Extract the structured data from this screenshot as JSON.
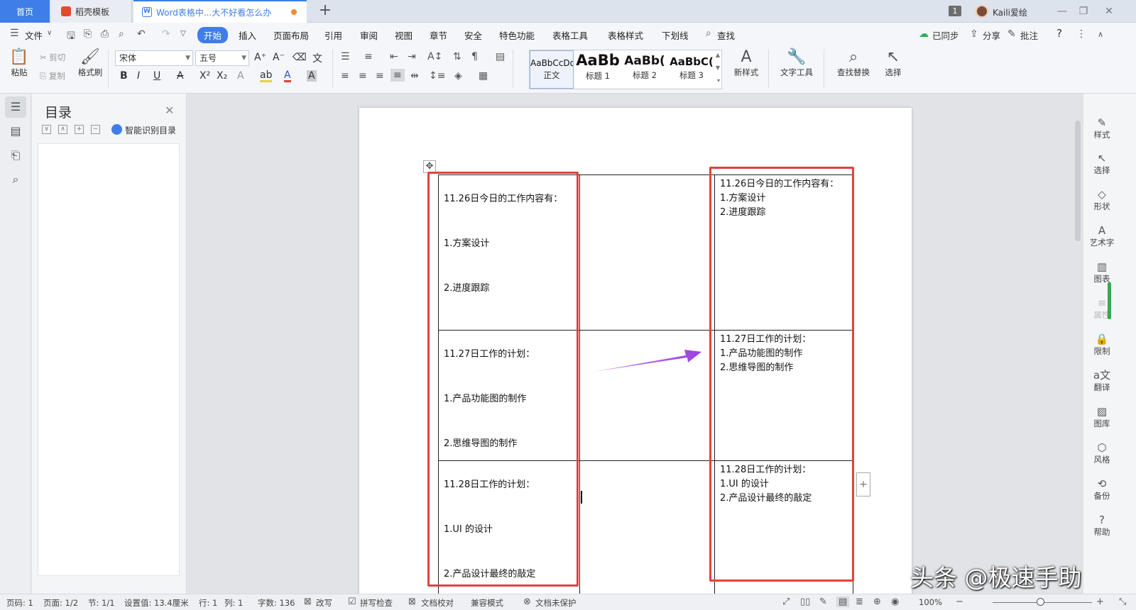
{
  "tabs": {
    "home": "首页",
    "daoke": "稻壳模板",
    "doc": "Word表格中...大不好看怎么办",
    "new_tab": "+"
  },
  "topbar": {
    "badge": "1",
    "user": "Kaili爱绘"
  },
  "menu": {
    "file": "文件",
    "items": [
      "开始",
      "插入",
      "页面布局",
      "引用",
      "审阅",
      "视图",
      "章节",
      "安全",
      "特色功能",
      "表格工具",
      "表格样式",
      "下划线"
    ],
    "search": "查找",
    "synced": "已同步",
    "share": "分享",
    "comment": "批注",
    "help": "?"
  },
  "ribbon": {
    "paste": "粘贴",
    "cut": "剪切",
    "copy": "复制",
    "format_painter": "格式刷",
    "font_name": "宋体",
    "font_size": "五号",
    "styles": [
      {
        "sample": "AaBbCcDd",
        "name": "正文"
      },
      {
        "sample": "AaBb",
        "name": "标题 1"
      },
      {
        "sample": "AaBb(",
        "name": "标题 2"
      },
      {
        "sample": "AaBbC(",
        "name": "标题 3"
      }
    ],
    "new_style": "新样式",
    "text_tools": "文字工具",
    "find_replace": "查找替换",
    "select": "选择"
  },
  "nav": {
    "title": "目录",
    "smart": "智能识别目录"
  },
  "document": {
    "left_cells": [
      {
        "title": "11.26日今日的工作内容有：",
        "items": [
          "1.方案设计",
          "2.进度跟踪"
        ]
      },
      {
        "title": "11.27日工作的计划：",
        "items": [
          "1.产品功能图的制作",
          "2.思维导图的制作"
        ]
      },
      {
        "title": "11.28日工作的计划：",
        "items": [
          "1.UI 的设计",
          "2.产品设计最终的敲定"
        ]
      }
    ],
    "right_cells": [
      {
        "title": "11.26日今日的工作内容有：",
        "items": [
          "1.方案设计",
          "2.进度跟踪"
        ]
      },
      {
        "title": "11.27日工作的计划：",
        "items": [
          "1.产品功能图的制作",
          "2.思维导图的制作"
        ]
      },
      {
        "title": "11.28日工作的计划：",
        "items": [
          "1.UI 的设计",
          "2.产品设计最终的敲定"
        ]
      }
    ],
    "highlight_color": "#e0423e",
    "arrow_color": "#a64fe0"
  },
  "right_panel": [
    "样式",
    "选择",
    "形状",
    "艺术字",
    "图表",
    "属性",
    "限制",
    "翻译",
    "图库",
    "风格",
    "备份",
    "帮助"
  ],
  "status": {
    "page_num": "页码: 1",
    "page": "页面: 1/2",
    "section": "节: 1/1",
    "setting": "设置值: 13.4厘米",
    "row": "行: 1",
    "col": "列: 1",
    "words": "字数: 136",
    "revise": "改写",
    "spell": "拼写检查",
    "proof": "文档校对",
    "compat": "兼容模式",
    "protect": "文档未保护",
    "zoom": "100%"
  },
  "watermark": "头条 @极速手助"
}
